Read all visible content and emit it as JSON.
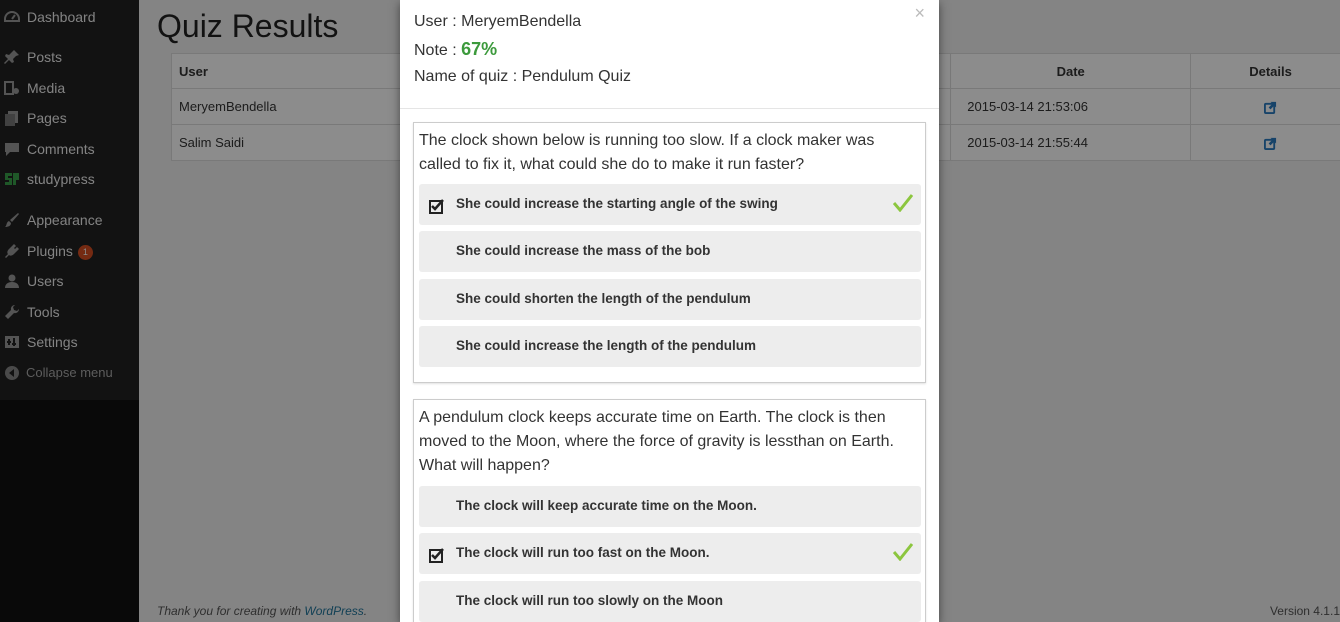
{
  "sidebar": {
    "items": [
      {
        "label": "Dashboard",
        "icon": "dashboard-icon"
      },
      {
        "label": "Posts",
        "icon": "pin-icon"
      },
      {
        "label": "Media",
        "icon": "media-icon"
      },
      {
        "label": "Pages",
        "icon": "pages-icon"
      },
      {
        "label": "Comments",
        "icon": "comment-icon"
      },
      {
        "label": "studypress",
        "icon": "studypress-icon"
      },
      {
        "label": "Appearance",
        "icon": "brush-icon"
      },
      {
        "label": "Plugins",
        "icon": "plugin-icon",
        "badge": "1"
      },
      {
        "label": "Users",
        "icon": "user-icon"
      },
      {
        "label": "Tools",
        "icon": "wrench-icon"
      },
      {
        "label": "Settings",
        "icon": "settings-icon"
      },
      {
        "label": "Collapse menu",
        "icon": "collapse-icon"
      }
    ]
  },
  "page": {
    "title": "Quiz Results",
    "table": {
      "headers": {
        "user": "User",
        "date": "Date",
        "details": "Details"
      },
      "rows": [
        {
          "user": "MeryemBendella",
          "date": "2015-03-14 21:53:06"
        },
        {
          "user": "Salim Saidi",
          "date": "2015-03-14 21:55:44"
        }
      ]
    },
    "footer": {
      "thanks": "Thank you for creating with ",
      "link": "WordPress",
      "dot": ".",
      "version": "Version 4.1.1"
    }
  },
  "modal": {
    "user_line": "User : MeryemBendella",
    "note_label": "Note : ",
    "note_value": "67%",
    "quiz_line": "Name of quiz : Pendulum Quiz",
    "close": "×",
    "questions": [
      {
        "text": "The clock shown below is running too slow. If a clock maker was called to fix it, what could she do to make it run faster?",
        "answers": [
          {
            "text": "She could increase the starting angle of the swing",
            "selected": true,
            "correct": true
          },
          {
            "text": "She could increase the mass of the bob",
            "selected": false,
            "correct": false
          },
          {
            "text": "She could shorten the length of the pendulum",
            "selected": false,
            "correct": false
          },
          {
            "text": "She could increase the length of the pendulum",
            "selected": false,
            "correct": false
          }
        ]
      },
      {
        "text": "A pendulum clock keeps accurate time on Earth. The clock is then moved to the Moon, where the force of gravity is lessthan on Earth. What will happen?",
        "answers": [
          {
            "text": "The clock will keep accurate time on the Moon.",
            "selected": false,
            "correct": false
          },
          {
            "text": "The clock will run too fast on the Moon.",
            "selected": true,
            "correct": true
          },
          {
            "text": "The clock will run too slowly on the Moon",
            "selected": false,
            "correct": false
          }
        ]
      }
    ]
  },
  "colors": {
    "note_green": "#3c9a3c",
    "tick_green": "#8cc63f",
    "sidebar_bg": "#222222",
    "badge": "#d54e21"
  }
}
